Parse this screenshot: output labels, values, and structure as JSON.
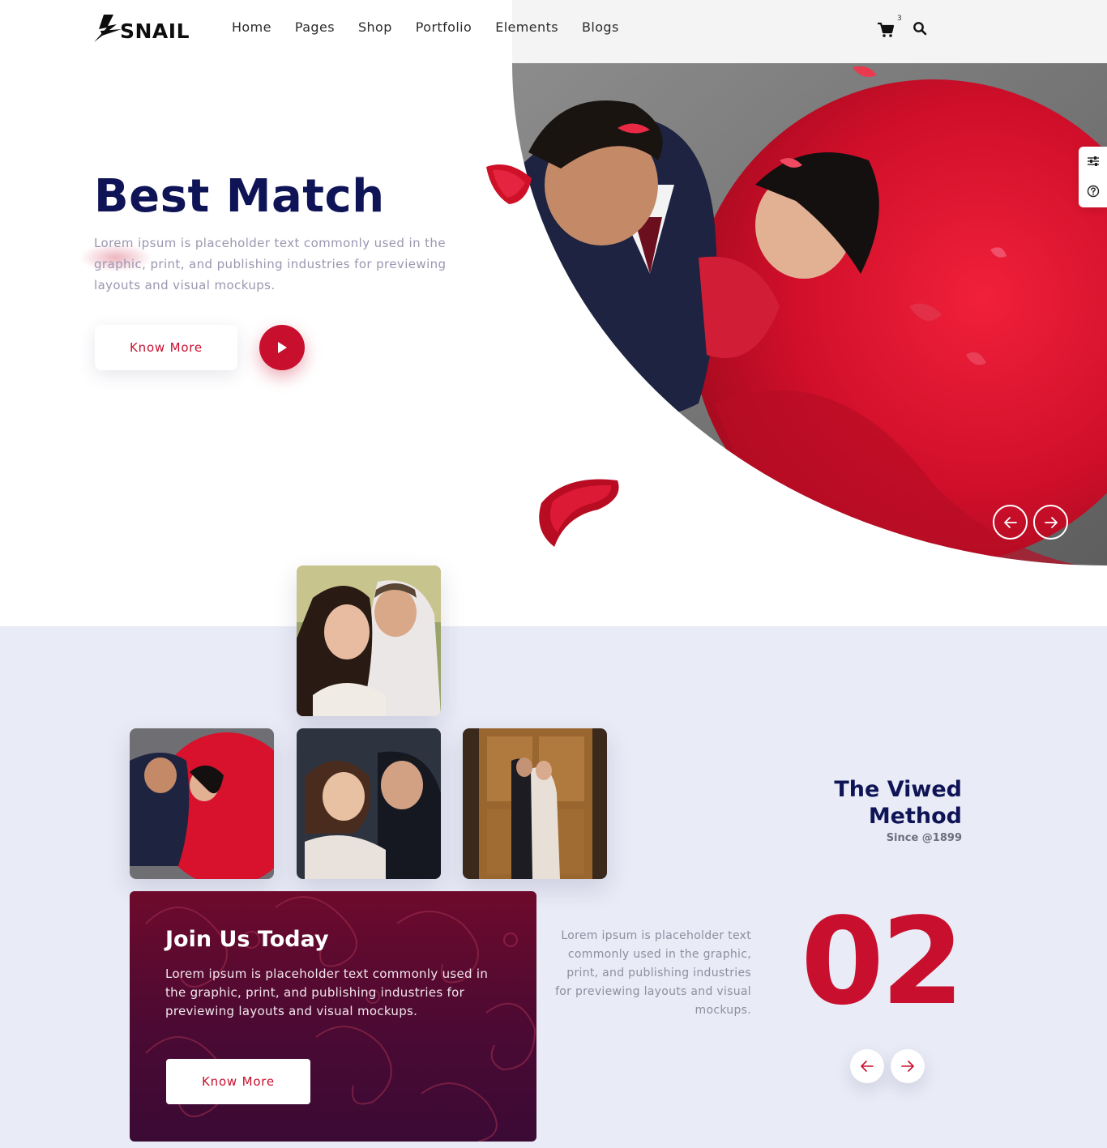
{
  "header": {
    "logo_text": "SNAIL",
    "nav": [
      "Home",
      "Pages",
      "Shop",
      "Portfolio",
      "Elements",
      "Blogs"
    ],
    "cart_count": "3",
    "icons": [
      "logo-bolt-icon",
      "cart-icon",
      "search-icon"
    ]
  },
  "hero": {
    "title": "Best Match",
    "text": "Lorem ipsum is placeholder text commonly used in the graphic, print, and publishing industries for previewing layouts and visual mockups.",
    "button_label": "Know More",
    "icons": [
      "play-icon",
      "arrow-left-icon",
      "arrow-right-icon"
    ]
  },
  "side_tools": [
    "settings-sliders-icon",
    "help-icon"
  ],
  "join": {
    "title": "Join Us Today",
    "text": "Lorem ipsum is placeholder text commonly used in the graphic, print, and publishing industries for previewing layouts and visual mockups.",
    "button_label": "Know More"
  },
  "method": {
    "title_line1": "The Viwed",
    "title_line2": "Method",
    "since": "Since @1899",
    "text": "Lorem ipsum is placeholder text commonly used in the graphic, print, and publishing industries for previewing layouts and visual mockups.",
    "number": "02"
  },
  "colors": {
    "accent": "#c8102e",
    "navy": "#0f1457",
    "section_bg": "#e9ebf6",
    "card_gradient_top": "#6e0a2c",
    "card_gradient_bottom": "#3a0a35"
  }
}
